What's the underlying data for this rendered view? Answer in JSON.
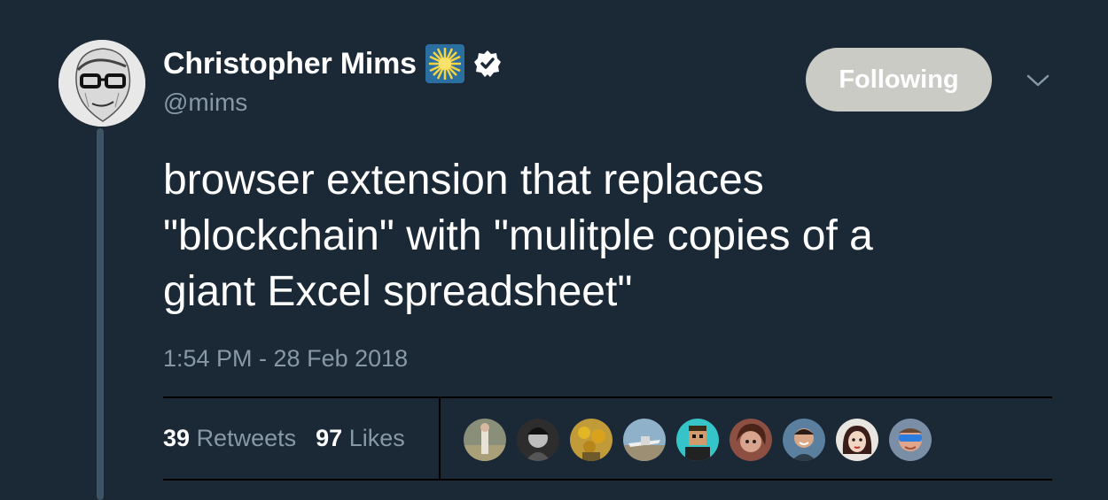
{
  "author": {
    "display_name": "Christopher Mims",
    "handle": "@mims",
    "avatar_icon": "sketch-portrait-avatar",
    "badge_icon": "sunburst-emoji-icon",
    "verified_icon": "verified-check-icon"
  },
  "follow_button": {
    "label": "Following",
    "bg": "#c9cbc4"
  },
  "menu_icon": "chevron-down-icon",
  "tweet": {
    "text": "browser extension that replaces\n\"blockchain\" with \"mulitple copies of a\ngiant Excel spreadsheet\"",
    "timestamp": "1:54 PM - 28 Feb 2018"
  },
  "stats": {
    "retweets_count": "39",
    "retweets_label": "Retweets",
    "likes_count": "97",
    "likes_label": "Likes"
  },
  "likers": [
    {
      "icon": "person-outdoor-avatar",
      "color": "#8a8f7a"
    },
    {
      "icon": "person-bw-avatar",
      "color": "#2d2d2d"
    },
    {
      "icon": "sunflowers-painting-avatar",
      "color": "#c19a3a"
    },
    {
      "icon": "airport-photo-avatar",
      "color": "#8fb1c9"
    },
    {
      "icon": "pixel-art-avatar",
      "color": "#35c4c8"
    },
    {
      "icon": "woman-portrait-avatar",
      "color": "#8c4f42"
    },
    {
      "icon": "man-smiling-avatar",
      "color": "#5a7f9f"
    },
    {
      "icon": "woman-illustration-avatar",
      "color": "#e9e6e2"
    },
    {
      "icon": "man-sunglasses-avatar",
      "color": "#7a8fa6"
    }
  ],
  "colors": {
    "background": "#1b2836",
    "secondary_text": "#8899a6",
    "thread_line": "#3d5466"
  }
}
